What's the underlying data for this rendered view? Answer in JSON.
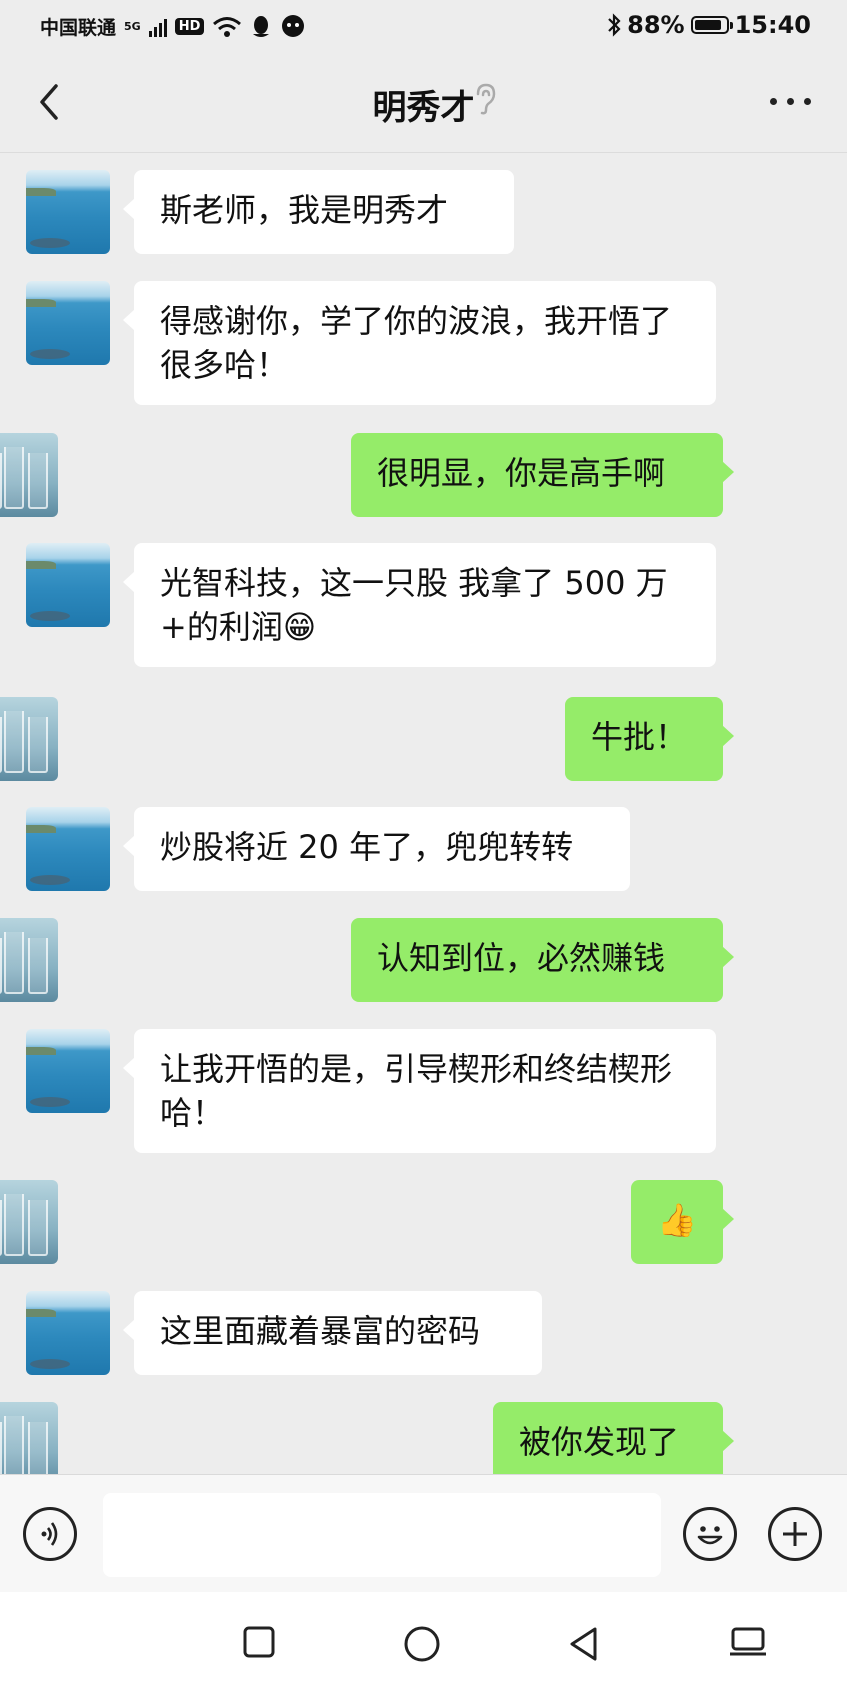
{
  "status_bar": {
    "carrier": "中国联通",
    "network": "5G",
    "hd_badge": "HD",
    "battery_percent": "88%",
    "time": "15:40",
    "icons": [
      "signal-icon",
      "wifi-icon",
      "qq-icon",
      "chat-app-icon",
      "bluetooth-icon",
      "battery-icon"
    ]
  },
  "header": {
    "title": "明秀才",
    "icons": [
      "back-icon",
      "ear-icon",
      "more-icon"
    ]
  },
  "messages": [
    {
      "side": "left",
      "text": "斯老师，我是明秀才"
    },
    {
      "side": "left",
      "text": "得感谢你，学了你的波浪，我开悟了很多哈！"
    },
    {
      "side": "right",
      "text": "很明显，你是高手啊"
    },
    {
      "side": "left",
      "text": "光智科技，这一只股 我拿了 500 万+的利润😁"
    },
    {
      "side": "right",
      "text": "牛批！"
    },
    {
      "side": "left",
      "text": "炒股将近 20 年了，兜兜转转"
    },
    {
      "side": "right",
      "text": "认知到位，必然赚钱"
    },
    {
      "side": "left",
      "text": "让我开悟的是，引导楔形和终结楔形哈！"
    },
    {
      "side": "right",
      "text": "👍"
    },
    {
      "side": "left",
      "text": "这里面藏着暴富的密码"
    },
    {
      "side": "right",
      "text": "被你发现了"
    }
  ],
  "input_bar": {
    "placeholder": "",
    "icons": [
      "voice-icon",
      "emoji-icon",
      "plus-icon"
    ]
  },
  "system_nav": {
    "icons": [
      "recent-apps-icon",
      "home-icon",
      "back-nav-icon",
      "keyboard-switch-icon"
    ]
  }
}
